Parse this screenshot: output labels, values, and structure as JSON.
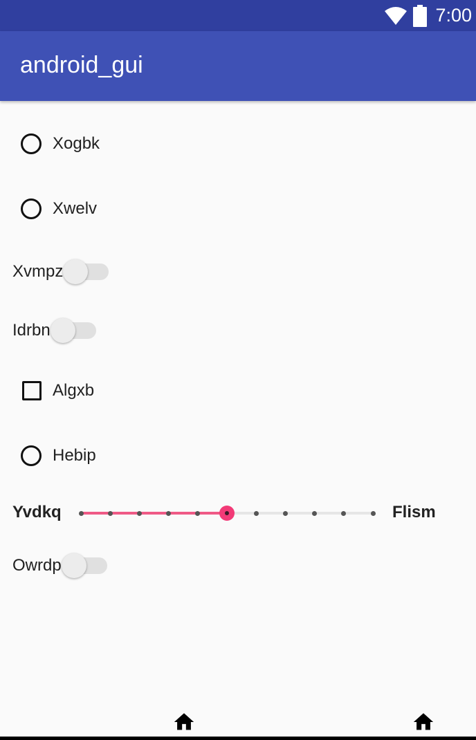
{
  "status_bar": {
    "time": "7:00",
    "icons": [
      "wifi-icon",
      "battery-icon"
    ]
  },
  "app_bar": {
    "title": "android_gui"
  },
  "controls": {
    "radio_1": {
      "label": "Xogbk",
      "checked": false
    },
    "radio_2": {
      "label": "Xwelv",
      "checked": false
    },
    "switch_1": {
      "label": "Xvmpz",
      "on": false
    },
    "switch_2": {
      "label": "Idrbn",
      "on": false
    },
    "checkbox_1": {
      "label": "Algxb",
      "checked": false
    },
    "radio_3": {
      "label": "Hebip",
      "checked": false
    },
    "seekbar": {
      "left_label": "Yvdkq",
      "right_label": "Flism",
      "max": 10,
      "value": 5
    },
    "switch_3": {
      "label": "Owrdp",
      "on": false
    }
  },
  "nav": {
    "icons": [
      "home-icon",
      "home-icon"
    ]
  },
  "colors": {
    "status_bar": "#303f9f",
    "app_bar": "#3f51b5",
    "accent": "#f23a77",
    "background": "#fafafa"
  }
}
